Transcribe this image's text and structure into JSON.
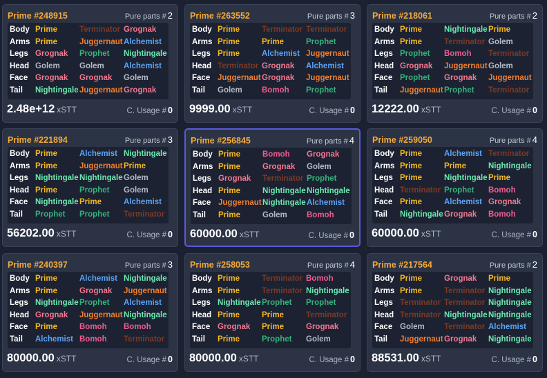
{
  "part_labels": [
    "Body",
    "Arms",
    "Legs",
    "Head",
    "Face",
    "Tail"
  ],
  "pure_parts_label": "Pure parts #",
  "usage_label": "C. Usage #",
  "price_unit": "xSTT",
  "class_colors": {
    "Prime": "#f5b81f",
    "Terminator": "#7a3a26",
    "Grognak": "#f2788f",
    "Juggernaut": "#f07f2e",
    "Alchemist": "#5aa3f5",
    "Prophet": "#35b27c",
    "Nightingale": "#6ce9b0",
    "Golem": "#b2bac6",
    "Bomoh": "#ef5c90"
  },
  "selected_index": 4,
  "cards": [
    {
      "title": "Prime #248915",
      "pure_parts": "2",
      "price": "2.48e+12",
      "usage": "0",
      "parts": [
        [
          "Prime",
          "Terminator",
          "Grognak"
        ],
        [
          "Prime",
          "Juggernaut",
          "Alchemist"
        ],
        [
          "Grognak",
          "Prophet",
          "Nightingale"
        ],
        [
          "Golem",
          "Golem",
          "Alchemist"
        ],
        [
          "Grognak",
          "Grognak",
          "Golem"
        ],
        [
          "Nightingale",
          "Juggernaut",
          "Grognak"
        ]
      ]
    },
    {
      "title": "Prime #263552",
      "pure_parts": "3",
      "price": "9999.00",
      "usage": "0",
      "parts": [
        [
          "Prime",
          "Terminator",
          "Terminator"
        ],
        [
          "Prime",
          "Prime",
          "Prophet"
        ],
        [
          "Prime",
          "Alchemist",
          "Juggernaut"
        ],
        [
          "Terminator",
          "Grognak",
          "Alchemist"
        ],
        [
          "Juggernaut",
          "Grognak",
          "Juggernaut"
        ],
        [
          "Golem",
          "Bomoh",
          "Prophet"
        ]
      ]
    },
    {
      "title": "Prime #218061",
      "pure_parts": "2",
      "price": "12222.00",
      "usage": "0",
      "parts": [
        [
          "Prime",
          "Nightingale",
          "Prime"
        ],
        [
          "Prime",
          "Terminator",
          "Golem"
        ],
        [
          "Prophet",
          "Bomoh",
          "Terminator"
        ],
        [
          "Grognak",
          "Juggernaut",
          "Golem"
        ],
        [
          "Prophet",
          "Grognak",
          "Juggernaut"
        ],
        [
          "Juggernaut",
          "Prophet",
          "Terminator"
        ]
      ]
    },
    {
      "title": "Prime #221894",
      "pure_parts": "3",
      "price": "56202.00",
      "usage": "0",
      "parts": [
        [
          "Prime",
          "Alchemist",
          "Nightingale"
        ],
        [
          "Prime",
          "Juggernaut",
          "Prime"
        ],
        [
          "Nightingale",
          "Nightingale",
          "Golem"
        ],
        [
          "Prime",
          "Prophet",
          "Golem"
        ],
        [
          "Nightingale",
          "Prime",
          "Alchemist"
        ],
        [
          "Prophet",
          "Prophet",
          "Terminator"
        ]
      ]
    },
    {
      "title": "Prime #256845",
      "pure_parts": "4",
      "price": "60000.00",
      "usage": "0",
      "parts": [
        [
          "Prime",
          "Bomoh",
          "Grognak"
        ],
        [
          "Prime",
          "Grognak",
          "Golem"
        ],
        [
          "Grognak",
          "Terminator",
          "Prophet"
        ],
        [
          "Prime",
          "Nightingale",
          "Nightingale"
        ],
        [
          "Juggernaut",
          "Nightingale",
          "Alchemist"
        ],
        [
          "Prime",
          "Golem",
          "Bomoh"
        ]
      ]
    },
    {
      "title": "Prime #259050",
      "pure_parts": "4",
      "price": "60000.00",
      "usage": "0",
      "parts": [
        [
          "Prime",
          "Alchemist",
          "Terminator"
        ],
        [
          "Prime",
          "Prime",
          "Nightingale"
        ],
        [
          "Prime",
          "Nightingale",
          "Prime"
        ],
        [
          "Terminator",
          "Prophet",
          "Bomoh"
        ],
        [
          "Prime",
          "Alchemist",
          "Grognak"
        ],
        [
          "Nightingale",
          "Grognak",
          "Bomoh"
        ]
      ]
    },
    {
      "title": "Prime #240397",
      "pure_parts": "3",
      "price": "80000.00",
      "usage": "0",
      "parts": [
        [
          "Prime",
          "Alchemist",
          "Nightingale"
        ],
        [
          "Prime",
          "Grognak",
          "Juggernaut"
        ],
        [
          "Nightingale",
          "Prophet",
          "Alchemist"
        ],
        [
          "Grognak",
          "Juggernaut",
          "Nightingale"
        ],
        [
          "Prime",
          "Bomoh",
          "Bomoh"
        ],
        [
          "Alchemist",
          "Bomoh",
          "Terminator"
        ]
      ]
    },
    {
      "title": "Prime #258053",
      "pure_parts": "4",
      "price": "80000.00",
      "usage": "0",
      "parts": [
        [
          "Prime",
          "Terminator",
          "Bomoh"
        ],
        [
          "Prime",
          "Terminator",
          "Nightingale"
        ],
        [
          "Nightingale",
          "Prophet",
          "Prophet"
        ],
        [
          "Prime",
          "Prime",
          "Terminator"
        ],
        [
          "Grognak",
          "Prime",
          "Grognak"
        ],
        [
          "Prime",
          "Prophet",
          "Golem"
        ]
      ]
    },
    {
      "title": "Prime #217564",
      "pure_parts": "2",
      "price": "88531.00",
      "usage": "0",
      "parts": [
        [
          "Prime",
          "Grognak",
          "Prime"
        ],
        [
          "Prime",
          "Terminator",
          "Nightingale"
        ],
        [
          "Terminator",
          "Terminator",
          "Nightingale"
        ],
        [
          "Terminator",
          "Nightingale",
          "Nightingale"
        ],
        [
          "Golem",
          "Terminator",
          "Alchemist"
        ],
        [
          "Juggernaut",
          "Grognak",
          "Nightingale"
        ]
      ]
    }
  ]
}
